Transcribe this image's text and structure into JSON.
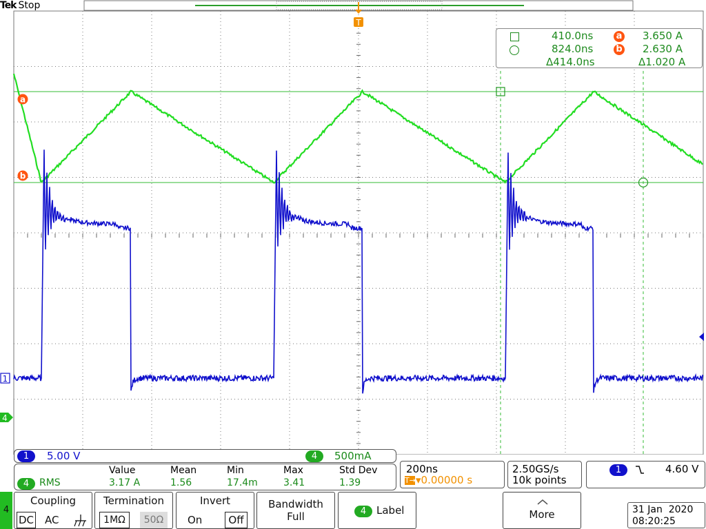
{
  "header": {
    "brand": "Tek",
    "status": "Stop",
    "trigger_marker": "T"
  },
  "cursor_readout": {
    "row1": {
      "time": "410.0ns",
      "ref": "a",
      "value": "3.650 A"
    },
    "row2": {
      "time": "824.0ns",
      "ref": "b",
      "value": "2.630 A"
    },
    "row3": {
      "delta_time": "Δ414.0ns",
      "delta_value": "Δ1.020 A"
    }
  },
  "markers": {
    "cursor_a": "a",
    "cursor_b": "b",
    "ch1_ground": "1",
    "ch4_ground": "4"
  },
  "channel_bar": {
    "ch1_num": "1",
    "ch1_scale": "5.00 V",
    "ch4_num": "4",
    "ch4_scale": "500mA"
  },
  "measurements": {
    "source_num": "4",
    "source_type": "RMS",
    "headers": [
      "Value",
      "Mean",
      "Min",
      "Max",
      "Std Dev"
    ],
    "values": [
      "3.17 A",
      "1.56",
      "17.4m",
      "3.41",
      "1.39"
    ]
  },
  "timebase": {
    "scale": "200ns",
    "delay": "▾0.00000 s",
    "delay_icon": "T→",
    "sample_rate": "2.50GS/s",
    "record": "10k points"
  },
  "trigger": {
    "source": "1",
    "slope_icon": "falling-edge",
    "level": "4.60 V"
  },
  "bottom_menu": {
    "side_tab": "4",
    "coupling": {
      "title": "Coupling",
      "dc": "DC",
      "ac": "AC",
      "gnd_icon": "ground-icon"
    },
    "termination": {
      "title": "Termination",
      "opt1": "1MΩ",
      "opt2": "50Ω"
    },
    "invert": {
      "title": "Invert",
      "on": "On",
      "off": "Off"
    },
    "bandwidth": {
      "title": "Bandwidth",
      "value": "Full"
    },
    "label": {
      "num": "4",
      "text": "Label"
    },
    "more": {
      "text": "More"
    }
  },
  "datetime": {
    "date": "31 Jan  2020",
    "time": "08:20:25"
  },
  "colors": {
    "ch1": "#1010d0",
    "ch4": "#22cc22",
    "cursor": "#1a9a1a",
    "ref": "#ff5511",
    "trigger_marker": "#f29100"
  },
  "chart_data": {
    "type": "line",
    "xlabel": "",
    "ylabel": "",
    "series": [
      {
        "name": "",
        "description": "ch4 inductor current",
        "x": [
          0,
          40,
          170,
          377,
          506,
          713,
          841,
          1000
        ],
        "y": [
          3.85,
          2.63,
          3.65,
          2.63,
          3.65,
          2.63,
          3.65,
          2.83
        ]
      },
      {
        "name": "",
        "description": "ch1 switch node voltage",
        "x": [
          0,
          40,
          44,
          170,
          173,
          377,
          380,
          506,
          509,
          713,
          716,
          841,
          844,
          1000
        ],
        "y": [
          0,
          0,
          13.0,
          11.8,
          0,
          0,
          13.0,
          11.8,
          0,
          0,
          13.0,
          11.8,
          0,
          0
        ]
      }
    ]
  }
}
